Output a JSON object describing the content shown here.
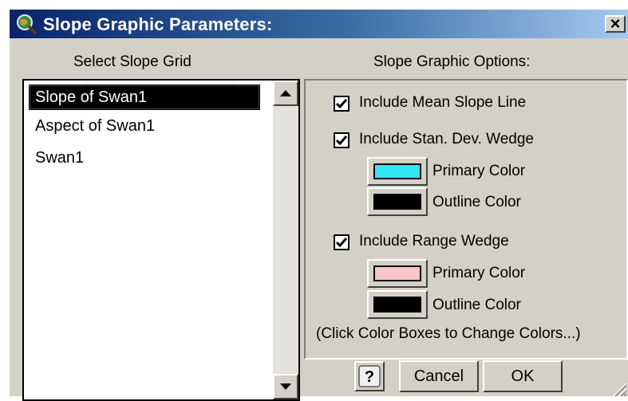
{
  "window": {
    "title": "Slope Graphic Parameters:",
    "close_label": "×"
  },
  "left": {
    "label": "Select Slope Grid",
    "items": [
      {
        "label": "Slope of Swan1",
        "selected": true
      },
      {
        "label": "Aspect of Swan1",
        "selected": false
      },
      {
        "label": "Swan1",
        "selected": false
      }
    ]
  },
  "options": {
    "label": "Slope Graphic Options:",
    "mean_line": {
      "label": "Include Mean Slope Line",
      "checked": true
    },
    "std_wedge": {
      "label": "Include Stan. Dev. Wedge",
      "checked": true,
      "primary_label": "Primary Color",
      "primary_color": "#33e6f5",
      "outline_label": "Outline Color",
      "outline_color": "#000000"
    },
    "range_wedge": {
      "label": "Include Range Wedge",
      "checked": true,
      "primary_label": "Primary Color",
      "primary_color": "#f7c4c8",
      "outline_label": "Outline Color",
      "outline_color": "#000000"
    },
    "hint": "(Click Color Boxes to Change Colors...)"
  },
  "buttons": {
    "help_label": "?",
    "cancel_label": "Cancel",
    "ok_label": "OK"
  },
  "colors": {
    "title_start": "#0a246a",
    "title_end": "#a6caf0",
    "face": "#d4d0c8"
  },
  "icons": [
    "map-magnifier-icon",
    "close-icon",
    "scroll-up-icon",
    "scroll-down-icon",
    "checkmark-icon",
    "help-icon",
    "resize-grip-icon"
  ]
}
